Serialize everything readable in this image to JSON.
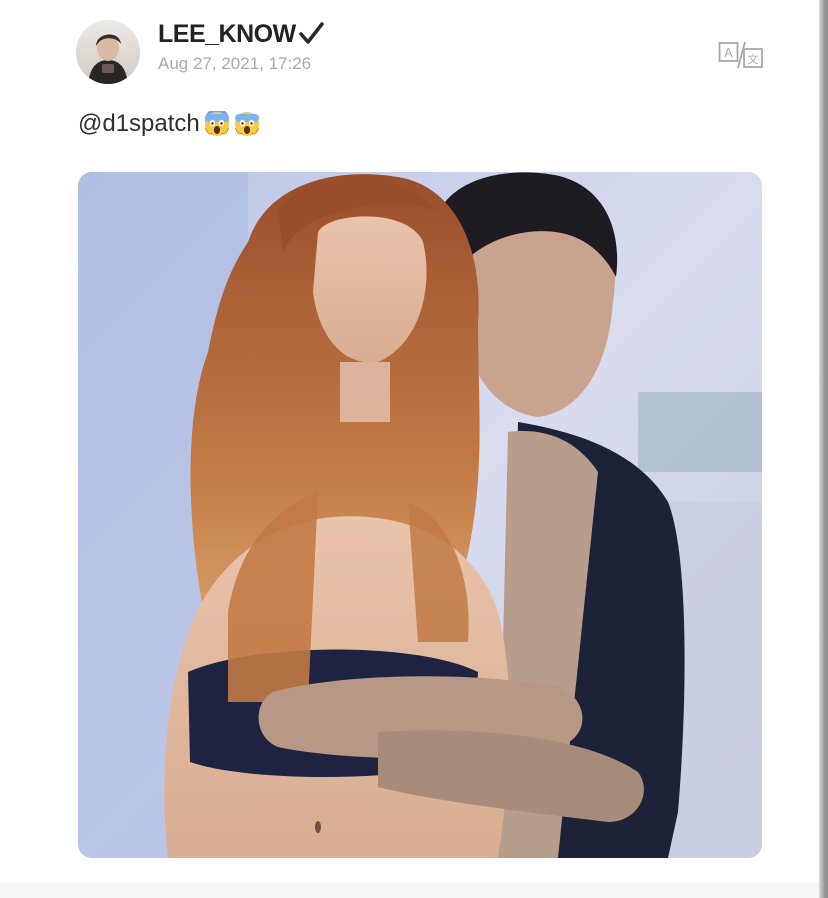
{
  "post": {
    "username": "LEE_KNOW",
    "timestamp": "Aug 27, 2021, 17:26",
    "text": "@d1spatch",
    "emojis": [
      "face-screaming-in-fear-emoji",
      "face-screaming-in-fear-emoji"
    ],
    "icons": {
      "verified": "checkmark-icon",
      "translate": "translate-icon",
      "avatar": "profile-avatar"
    },
    "image": {
      "description_icon": "photo-image"
    }
  },
  "colors": {
    "username": "#222222",
    "timestamp": "#a9a9a9",
    "text": "#303030",
    "photo_background": "#c9d2ec"
  }
}
